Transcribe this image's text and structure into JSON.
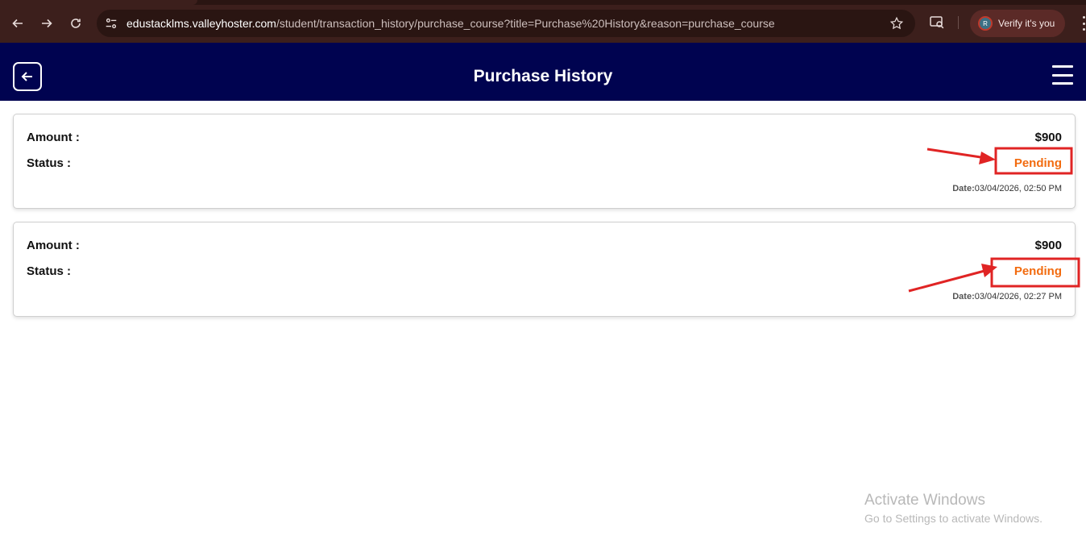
{
  "browser": {
    "url_host": "edustacklms.valleyhoster.com",
    "url_path": "/student/transaction_history/purchase_course?title=Purchase%20History&reason=purchase_course",
    "profile_initial": "R",
    "verify_label": "Verify it's you"
  },
  "header": {
    "title": "Purchase History"
  },
  "transactions": [
    {
      "amount_label": "Amount :",
      "status_label": "Status :",
      "amount": "$900",
      "status": "Pending",
      "date_label": "Date:",
      "date": "03/04/2026, 02:50 PM"
    },
    {
      "amount_label": "Amount :",
      "status_label": "Status :",
      "amount": "$900",
      "status": "Pending",
      "date_label": "Date:",
      "date": "03/04/2026, 02:27 PM"
    }
  ],
  "watermark": {
    "title": "Activate Windows",
    "subtitle": "Go to Settings to activate Windows."
  },
  "colors": {
    "header_bg": "#000350",
    "status_pending": "#f26b0f",
    "annotation_red": "#e02424",
    "chrome_bg": "#3c1f1c"
  }
}
